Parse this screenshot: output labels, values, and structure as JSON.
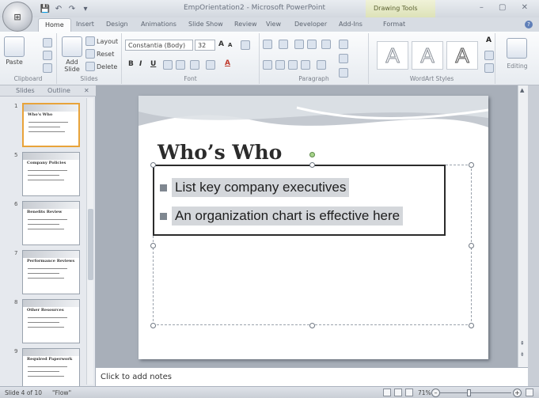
{
  "window": {
    "title": "EmpOrientation2 - Microsoft PowerPoint",
    "contextual_tab_group": "Drawing Tools",
    "office_button_label": "⊞",
    "window_controls": "–  ▢  ✕"
  },
  "quick_access": {
    "save": "💾",
    "undo": "↶",
    "redo": "↷",
    "customize": "▾"
  },
  "tabs": [
    "Home",
    "Insert",
    "Design",
    "Animations",
    "Slide Show",
    "Review",
    "View",
    "Developer",
    "Add-Ins",
    "Format"
  ],
  "active_tab": "Home",
  "ribbon": {
    "clipboard": {
      "paste": "Paste",
      "label": "Clipboard"
    },
    "slides": {
      "add_slide": "Add Slide",
      "layout": "Layout",
      "reset": "Reset",
      "delete": "Delete",
      "label": "Slides"
    },
    "font": {
      "font_name": "Constantia (Body)",
      "font_size": "32",
      "bold": "B",
      "italic": "I",
      "underline": "U",
      "label": "Font"
    },
    "paragraph": {
      "label": "Paragraph"
    },
    "wordart": {
      "sample": "A",
      "label": "WordArt Styles"
    },
    "editing": {
      "label": "Editing"
    }
  },
  "slide_pane": {
    "tabs": [
      "Slides",
      "Outline"
    ],
    "thumbnails": [
      {
        "number": "1",
        "title": "Who's Who"
      },
      {
        "number": "5",
        "title": "Company Policies"
      },
      {
        "number": "6",
        "title": "Benefits Review"
      },
      {
        "number": "7",
        "title": "Performance Reviews"
      },
      {
        "number": "8",
        "title": "Other Resources"
      },
      {
        "number": "9",
        "title": "Required Paperwork"
      }
    ],
    "selected_index": 0
  },
  "slide": {
    "title": "Who’s Who",
    "bullets": [
      "List key company executives",
      "An organization chart is effective here"
    ]
  },
  "notes": {
    "placeholder": "Click to add notes"
  },
  "status": {
    "slide_info": "Slide 4 of 10",
    "theme": "\"Flow\"",
    "zoom": "71%",
    "zoom_out": "–",
    "zoom_in": "+"
  }
}
